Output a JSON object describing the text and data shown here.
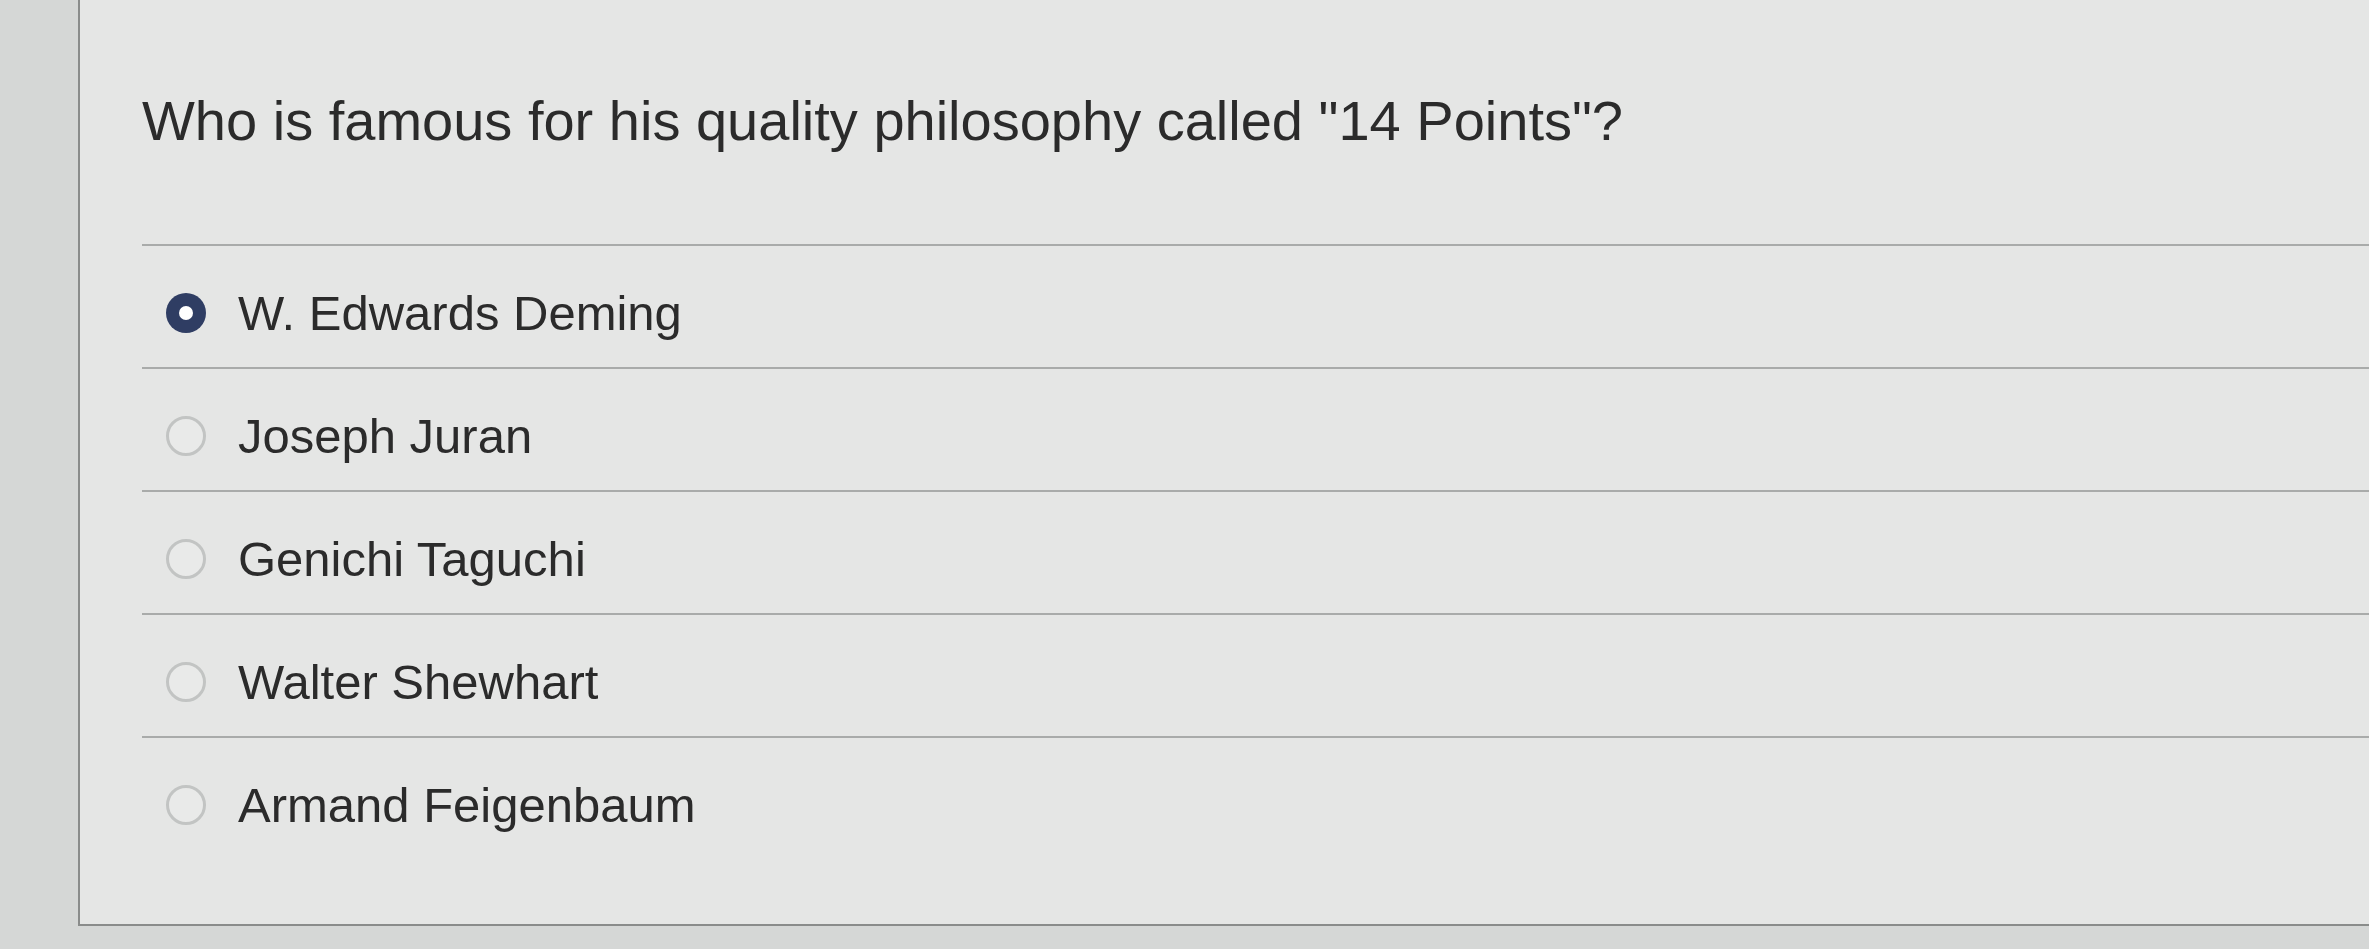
{
  "question": {
    "text": "Who is famous for his quality philosophy called \"14 Points\"?"
  },
  "options": [
    {
      "label": "W. Edwards Deming",
      "selected": true
    },
    {
      "label": "Joseph Juran",
      "selected": false
    },
    {
      "label": "Genichi Taguchi",
      "selected": false
    },
    {
      "label": "Walter Shewhart",
      "selected": false
    },
    {
      "label": "Armand Feigenbaum",
      "selected": false
    }
  ]
}
